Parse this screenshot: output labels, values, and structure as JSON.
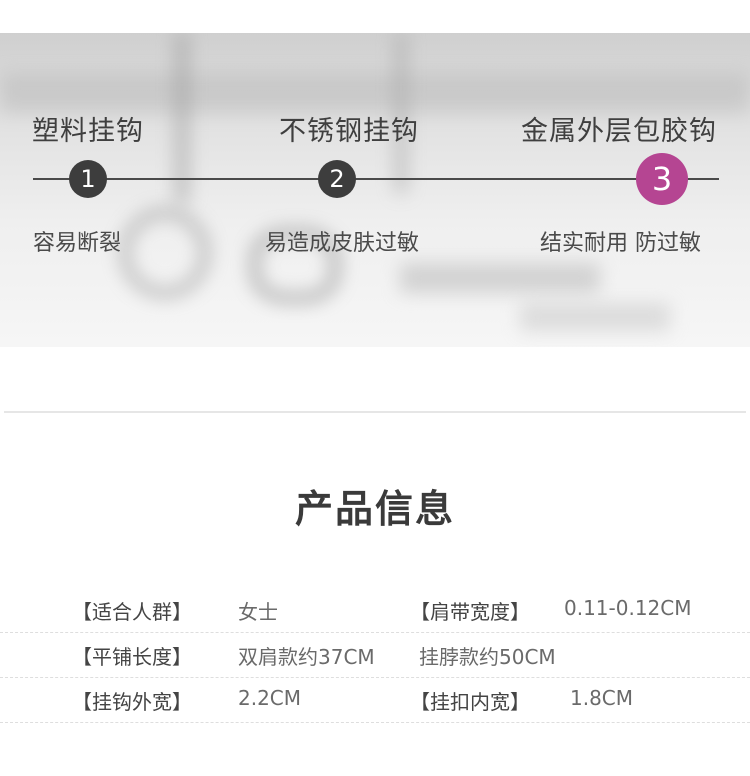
{
  "comparison": {
    "stages": [
      {
        "name": "塑料挂钩",
        "step": "1",
        "desc": "容易断裂"
      },
      {
        "name": "不锈钢挂钩",
        "step": "2",
        "desc": "易造成皮肤过敏"
      },
      {
        "name": "金属外层包胶钩",
        "step": "3",
        "desc": "结实耐用 防过敏"
      }
    ],
    "active_color": "#b54592",
    "badge_color": "#3d3d3d"
  },
  "product_info": {
    "title": "产品信息",
    "rows": [
      {
        "label1": "【适合人群】",
        "value1": "女士",
        "label2": "【肩带宽度】",
        "value2": "0.11-0.12CM"
      },
      {
        "label1": "【平铺长度】",
        "value1": "双肩款约37CM",
        "label2": "挂脖款约50CM",
        "value2": ""
      },
      {
        "label1": "【挂钩外宽】",
        "value1": "2.2CM",
        "label2": "【挂扣内宽】",
        "value2": "1.8CM"
      }
    ]
  }
}
